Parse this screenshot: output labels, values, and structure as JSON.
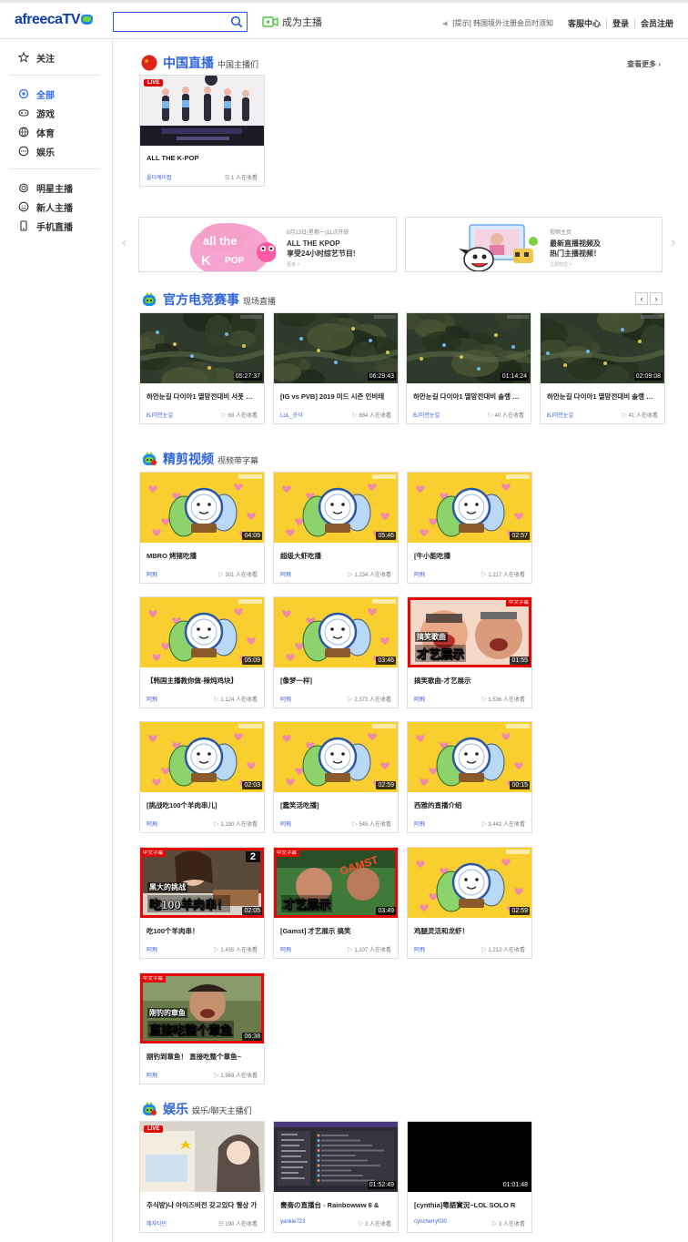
{
  "header": {
    "logo_text": "afreeca",
    "logo_tv": "TV",
    "search_placeholder": "",
    "broadcast_label": "成为主播",
    "notice": "[提示] 韩国境外注册会员时须知",
    "links": [
      "客服中心",
      "登录",
      "会员注册"
    ]
  },
  "sidebar": {
    "top": "关注",
    "group1": [
      "全部",
      "游戏",
      "体育",
      "娱乐"
    ],
    "group2": [
      "明星主播",
      "新人主播",
      "手机直播"
    ]
  },
  "sections": {
    "china": {
      "title": "中国直播",
      "sub": "中国主播们",
      "more": "查看更多"
    },
    "esports": {
      "title": "官方电竞赛事",
      "sub": "现场直播"
    },
    "clips": {
      "title": "精剪视频",
      "sub": "视频带字幕"
    },
    "ent": {
      "title": "娱乐",
      "sub": "娱乐/聊天主播们"
    }
  },
  "banners": {
    "b1": {
      "t1": "8月13日(星期一)11点开放",
      "t2a": "ALL THE KPOP",
      "t2b": "享受24小时综艺节目!",
      "t3": "更多 >"
    },
    "b2": {
      "t1": "视频主页",
      "t2a": "最新直播视频及",
      "t2b": "热门主播视频！",
      "t3": "立即前往 >"
    }
  },
  "china_cards": [
    {
      "title": "ALL THE K-POP",
      "author": "올더케이팝",
      "meta": "1 人在收看",
      "live": "LIVE"
    }
  ],
  "esports_cards": [
    {
      "title": "하안눈길 다이아1 멸망전대비 서폿 솔랭",
      "author": "BJ하안눈길",
      "meta": "68 人在收看",
      "dur": "05:27:37"
    },
    {
      "title": "[IG vs PVB] 2019 미드 시즌 인비테",
      "author": "LoL_공식",
      "meta": "884 人在收看",
      "dur": "06:29:43"
    },
    {
      "title": "하안눈길 다이아1 멸망전대비 솔랭 서폿",
      "author": "BJ하안눈길",
      "meta": "40 人在收看",
      "dur": "01:14:24"
    },
    {
      "title": "하안눈길 다이아1 멸망전대비 솔랭 서폿",
      "author": "BJ하안눈길",
      "meta": "41 人在收看",
      "dur": "02:09:08"
    }
  ],
  "clip_cards": [
    {
      "title": "MBRO 烤猪吃播",
      "author": "阿飛",
      "meta": "301 人在收看",
      "dur": "04:09"
    },
    {
      "title": "超级大虾吃播",
      "author": "阿飛",
      "meta": "1,234 人在收看",
      "dur": "05:46"
    },
    {
      "title": "[牛小能吃播",
      "author": "阿飛",
      "meta": "1,217 人在收看",
      "dur": "02:57"
    },
    {
      "title": "【韩国主播教你做-辣炖鸡块】",
      "author": "阿飛",
      "meta": "1,124 人在收看",
      "dur": "05:09"
    },
    {
      "title": "[像梦一样]",
      "author": "阿飛",
      "meta": "2,373 人在收看",
      "dur": "03:46"
    },
    {
      "title": "搞笑歌曲-才艺展示",
      "author": "阿飛",
      "meta": "1,536 人在收看",
      "dur": "01:55",
      "tag": "中文字幕",
      "cap1": "搞笑歌曲",
      "cap2": "才艺展示"
    },
    {
      "title": "[挑战吃100个羊肉串儿]",
      "author": "阿飛",
      "meta": "1,190 人在收看",
      "dur": "02:03"
    },
    {
      "title": "[蠢笑活吃播]",
      "author": "阿飛",
      "meta": "545 人在收看",
      "dur": "02:59"
    },
    {
      "title": "西雅的直播介绍",
      "author": "阿飛",
      "meta": "3,442 人在收看",
      "dur": "00:15"
    },
    {
      "title": "吃100个羊肉串！",
      "author": "阿飛",
      "meta": "1,435 人在收看",
      "dur": "02:05",
      "tag": "中文字幕",
      "cap1": "黑大的挑战",
      "cap2": "吃100羊肉串！",
      "num": "2"
    },
    {
      "title": "[Gamst] 才艺展示 搞笑",
      "author": "阿飛",
      "meta": "1,107 人在收看",
      "dur": "03:49",
      "tag": "中文字幕",
      "cap1": "GAMST",
      "cap2": "才艺展示"
    },
    {
      "title": "鸡腿灵活和龙虾！",
      "author": "阿飛",
      "meta": "1,213 人在收看",
      "dur": "02:59"
    },
    {
      "title": "刚钓到章鱼！ 直接吃整个章鱼~",
      "author": "阿飛",
      "meta": "1,968 人在收看",
      "dur": "06:38",
      "tag": "中文字幕",
      "cap1": "刚钓的章鱼",
      "cap2": "直接吃整个章鱼"
    }
  ],
  "ent_cards": [
    {
      "title": "주식방)나 아이즈비전 갖고있다 퀭상 가",
      "author": "혜자타민",
      "meta": "190 人在收看",
      "live": "LIVE"
    },
    {
      "title": "書斋の直播台 - Rainbowww 6 &",
      "author": "yankie723",
      "meta": "3 人在收看",
      "dur": "01:52:49"
    },
    {
      "title": "[cynthia]粤語實況~LOL SOLO R",
      "author": "cyncherry030",
      "meta": "3 人在收看",
      "dur": "01:01:48"
    }
  ]
}
